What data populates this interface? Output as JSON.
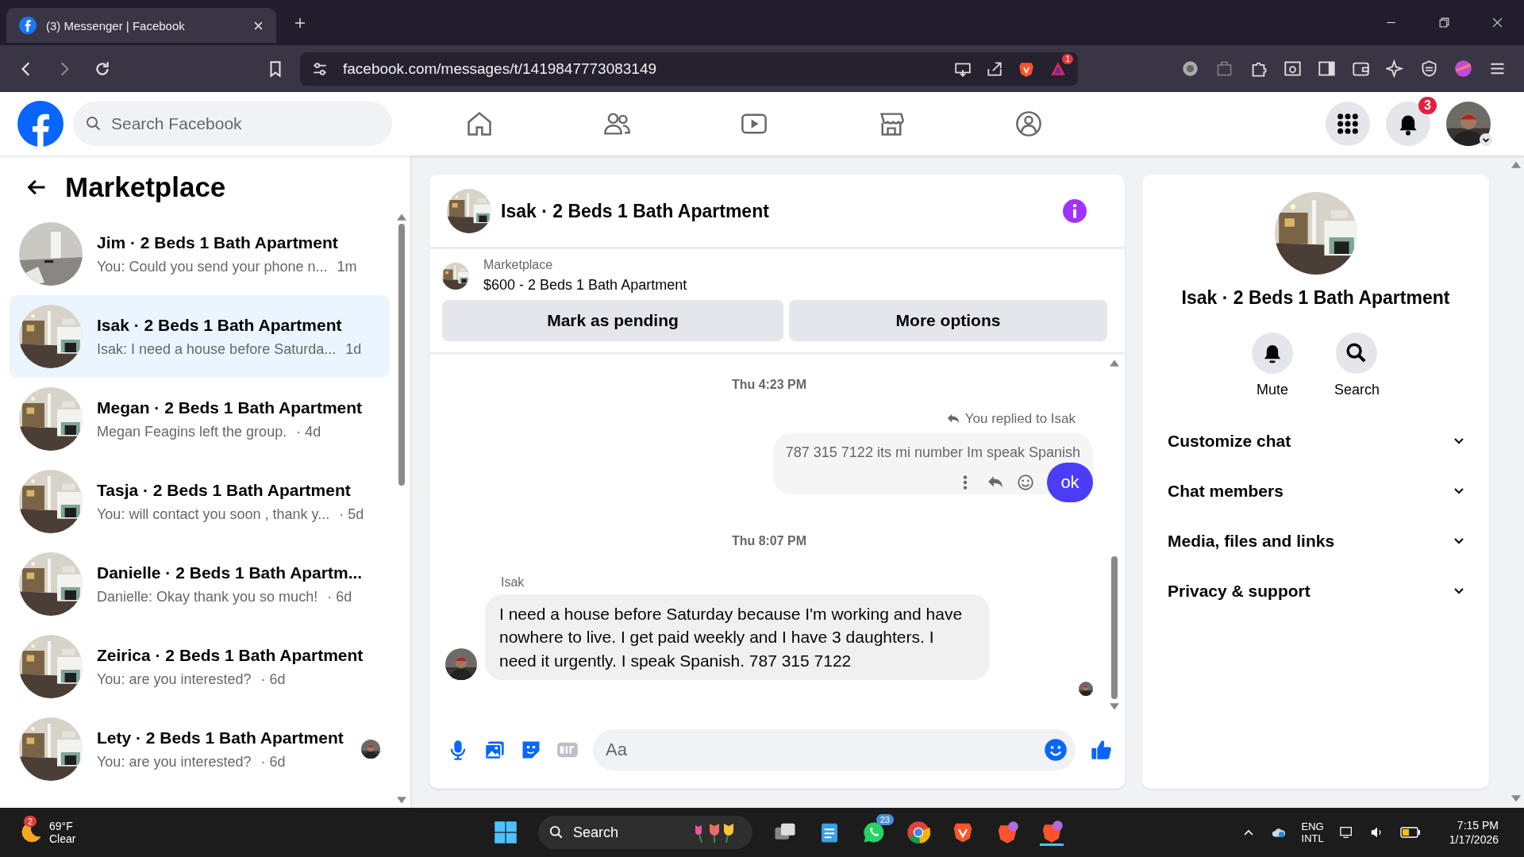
{
  "browser": {
    "tab": {
      "title": "(3) Messenger | Facebook",
      "selected": true
    },
    "url": "facebook.com/messages/t/1419847773083149",
    "extension_badge": "1"
  },
  "facebook_header": {
    "search": {
      "placeholder": "Search Facebook"
    },
    "notification_count": "3"
  },
  "sidebar": {
    "title": "Marketplace",
    "conversations": [
      {
        "title": "Jim · 2 Beds 1 Bath Apartment",
        "preview": "You: Could you send your phone n...",
        "time": "1m",
        "selected": false,
        "seen_avatar": false
      },
      {
        "title": "Isak · 2 Beds 1 Bath Apartment",
        "preview": "Isak: I need a house before Saturda...",
        "time": "1d",
        "selected": true,
        "seen_avatar": false
      },
      {
        "title": "Megan · 2 Beds 1 Bath Apartment",
        "preview": "Megan Feagins left the group.",
        "time": "· 4d",
        "selected": false,
        "seen_avatar": false
      },
      {
        "title": "Tasja · 2 Beds 1 Bath Apartment",
        "preview": "You: will contact you soon , thank y...",
        "time": "· 5d",
        "selected": false,
        "seen_avatar": false
      },
      {
        "title": "Danielle · 2 Beds 1 Bath Apartm...",
        "preview": "Danielle: Okay thank you so much!",
        "time": "· 6d",
        "selected": false,
        "seen_avatar": false
      },
      {
        "title": "Zeirica · 2 Beds 1 Bath Apartment",
        "preview": "You: are you interested?",
        "time": "· 6d",
        "selected": false,
        "seen_avatar": false
      },
      {
        "title": "Lety · 2 Beds 1 Bath Apartment",
        "preview": "You: are you interested?",
        "time": "· 6d",
        "selected": false,
        "seen_avatar": true
      }
    ]
  },
  "chat": {
    "title": "Isak · 2 Beds 1 Bath Apartment",
    "listing": {
      "label": "Marketplace",
      "item": "$600 - 2 Beds 1 Bath Apartment"
    },
    "buttons": [
      "Mark as pending",
      "More options"
    ],
    "messages": [
      {
        "kind": "timestamp",
        "text": "Thu 4:23 PM"
      },
      {
        "kind": "outgoing",
        "reply_note": "You replied to Isak",
        "text": "787 315 7122 its mi number Im speak Spanish",
        "reaction": "ok"
      },
      {
        "kind": "timestamp",
        "text": "Thu 8:07 PM"
      },
      {
        "kind": "incoming",
        "sender": "Isak",
        "text": "I need a house before Saturday because I'm working and have nowhere to live. I get paid weekly and I have 3 daughters. I need it urgently. I speak Spanish. 787 315 7122"
      }
    ],
    "composer": {
      "placeholder": "Aa"
    }
  },
  "info_panel": {
    "title": "Isak · 2 Beds 1 Bath Apartment",
    "actions": [
      {
        "kind": "bell",
        "label": "Mute"
      },
      {
        "kind": "search",
        "label": "Search"
      }
    ],
    "sections": [
      {
        "label": "Customize chat",
        "expanded": false
      },
      {
        "label": "Chat members",
        "expanded": false
      },
      {
        "label": "Media, files and links",
        "expanded": false
      },
      {
        "label": "Privacy & support",
        "expanded": false
      }
    ]
  },
  "taskbar": {
    "weather": {
      "badge": "2",
      "temperature": "69°F",
      "condition": "Clear"
    },
    "search": {
      "placeholder": "Search"
    },
    "whatsapp_badge": "23",
    "language": [
      "ENG",
      "INTL"
    ],
    "time": "7:15 PM",
    "date": "1/17/2026"
  }
}
